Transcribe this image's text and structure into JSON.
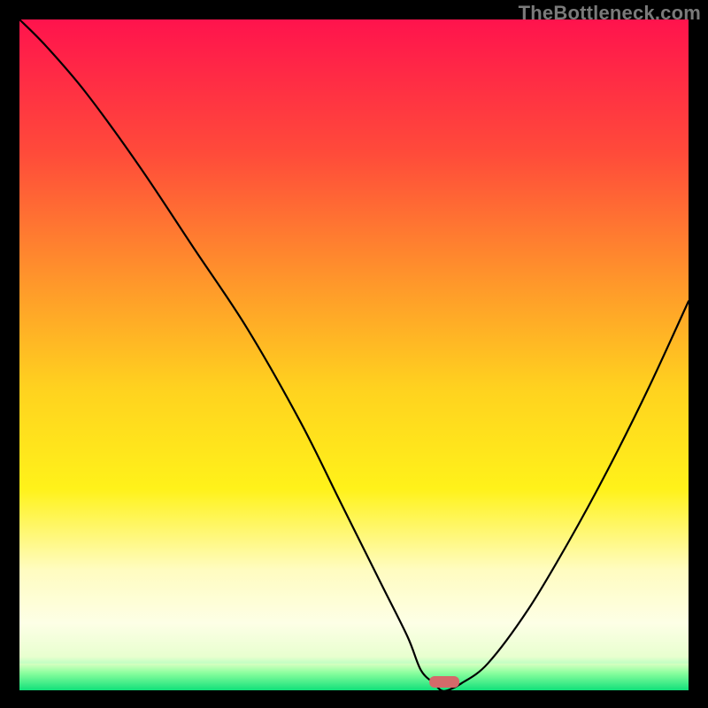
{
  "watermark": "TheBottleneck.com",
  "chart_data": {
    "type": "line",
    "title": "",
    "xlabel": "",
    "ylabel": "",
    "xlim": [
      0,
      100
    ],
    "ylim": [
      0,
      100
    ],
    "series": [
      {
        "name": "bottleneck-curve",
        "x": [
          0,
          4,
          10,
          18,
          26,
          34,
          42,
          48,
          54,
          58,
          60,
          62,
          63,
          64,
          66,
          70,
          76,
          82,
          88,
          94,
          100
        ],
        "values": [
          100,
          96,
          89,
          78,
          66,
          54,
          40,
          28,
          16,
          8,
          3,
          1,
          0,
          0,
          1,
          4,
          12,
          22,
          33,
          45,
          58
        ]
      }
    ],
    "optimal_marker": {
      "x": 63.5,
      "width": 4.5,
      "color": "#d46a6a"
    },
    "green_band": {
      "y_start": 96,
      "y_end": 100
    },
    "gradient_stops": [
      {
        "offset": 0,
        "color": "#ff134d"
      },
      {
        "offset": 20,
        "color": "#ff4b3a"
      },
      {
        "offset": 40,
        "color": "#ff9a2a"
      },
      {
        "offset": 55,
        "color": "#ffd21f"
      },
      {
        "offset": 70,
        "color": "#fff21a"
      },
      {
        "offset": 82,
        "color": "#fffcc0"
      },
      {
        "offset": 90,
        "color": "#fdffe6"
      },
      {
        "offset": 95,
        "color": "#e8ffcf"
      },
      {
        "offset": 100,
        "color": "#19ff8c"
      }
    ]
  }
}
